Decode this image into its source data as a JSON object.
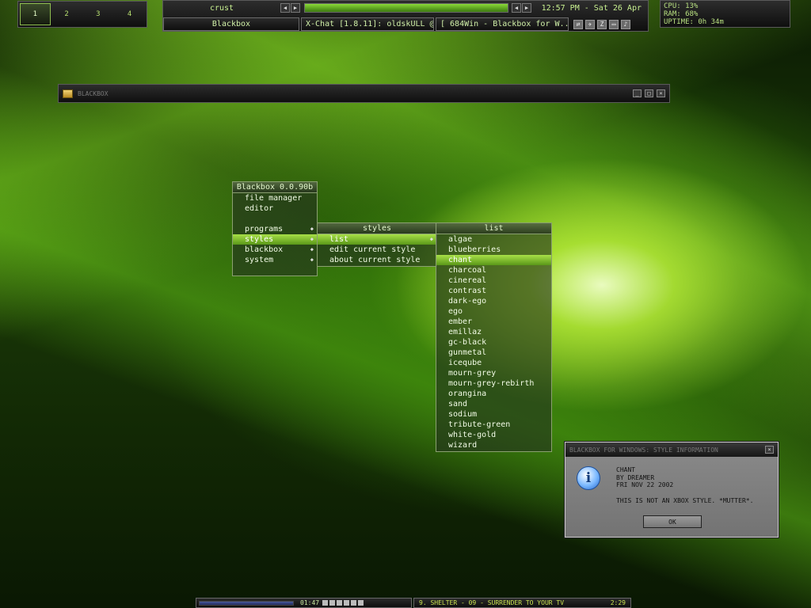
{
  "pager": {
    "workspaces": [
      "1",
      "2",
      "3",
      "4"
    ],
    "active": 0
  },
  "toolbar": {
    "label": "crust",
    "clock": "12:57 PM - Sat 26 Apr",
    "tasks": [
      {
        "label": "Blackbox",
        "active": true
      },
      {
        "label": "X-Chat [1.8.11]: oldskULL @...",
        "active": false
      },
      {
        "label": "[ 684Win - Blackbox for W...",
        "active": false
      }
    ],
    "tray_icons": [
      "network-icon",
      "satellite-icon",
      "zonealarm-icon",
      "monitor-icon",
      "speaker-icon"
    ]
  },
  "sysmon": {
    "cpu": "CPU: 13%",
    "ram": "RAM: 68%",
    "uptime": "UPTIME: 0h 34m"
  },
  "bbwindow": {
    "title": "BLACKBOX"
  },
  "menu_main": {
    "title": "Blackbox 0.0.90b",
    "items": [
      {
        "label": "file manager",
        "submenu": false
      },
      {
        "label": "editor",
        "submenu": false
      },
      {
        "label": "",
        "submenu": false
      },
      {
        "label": "programs",
        "submenu": true
      },
      {
        "label": "styles",
        "submenu": true
      },
      {
        "label": "blackbox",
        "submenu": true
      },
      {
        "label": "system",
        "submenu": true
      }
    ],
    "highlighted": 4
  },
  "menu_styles": {
    "title": "styles",
    "items": [
      {
        "label": "list",
        "submenu": true
      },
      {
        "label": "edit current style",
        "submenu": false
      },
      {
        "label": "about current style",
        "submenu": false
      }
    ],
    "highlighted": 0
  },
  "menu_list": {
    "title": "list",
    "items": [
      "algae",
      "blueberries",
      "chant",
      "charcoal",
      "cinereal",
      "contrast",
      "dark-ego",
      "ego",
      "ember",
      "emillaz",
      "gc-black",
      "gunmetal",
      "iceqube",
      "mourn-grey",
      "mourn-grey-rebirth",
      "orangina",
      "sand",
      "sodium",
      "tribute-green",
      "white-gold",
      "wizard"
    ],
    "highlighted": 2
  },
  "dialog": {
    "title": "BLACKBOX FOR WINDOWS: STYLE INFORMATION",
    "line1": "CHANT",
    "line2": "BY DREAMER",
    "line3": "FRI NOV 22 2002",
    "line4": "THIS IS NOT AN XBOX STYLE. *MUTTER*.",
    "ok": "OK"
  },
  "bottombar": {
    "player_time": "01:47",
    "song": "9. SHELTER - 09 - SURRENDER TO YOUR TV",
    "song_time": "2:29"
  }
}
